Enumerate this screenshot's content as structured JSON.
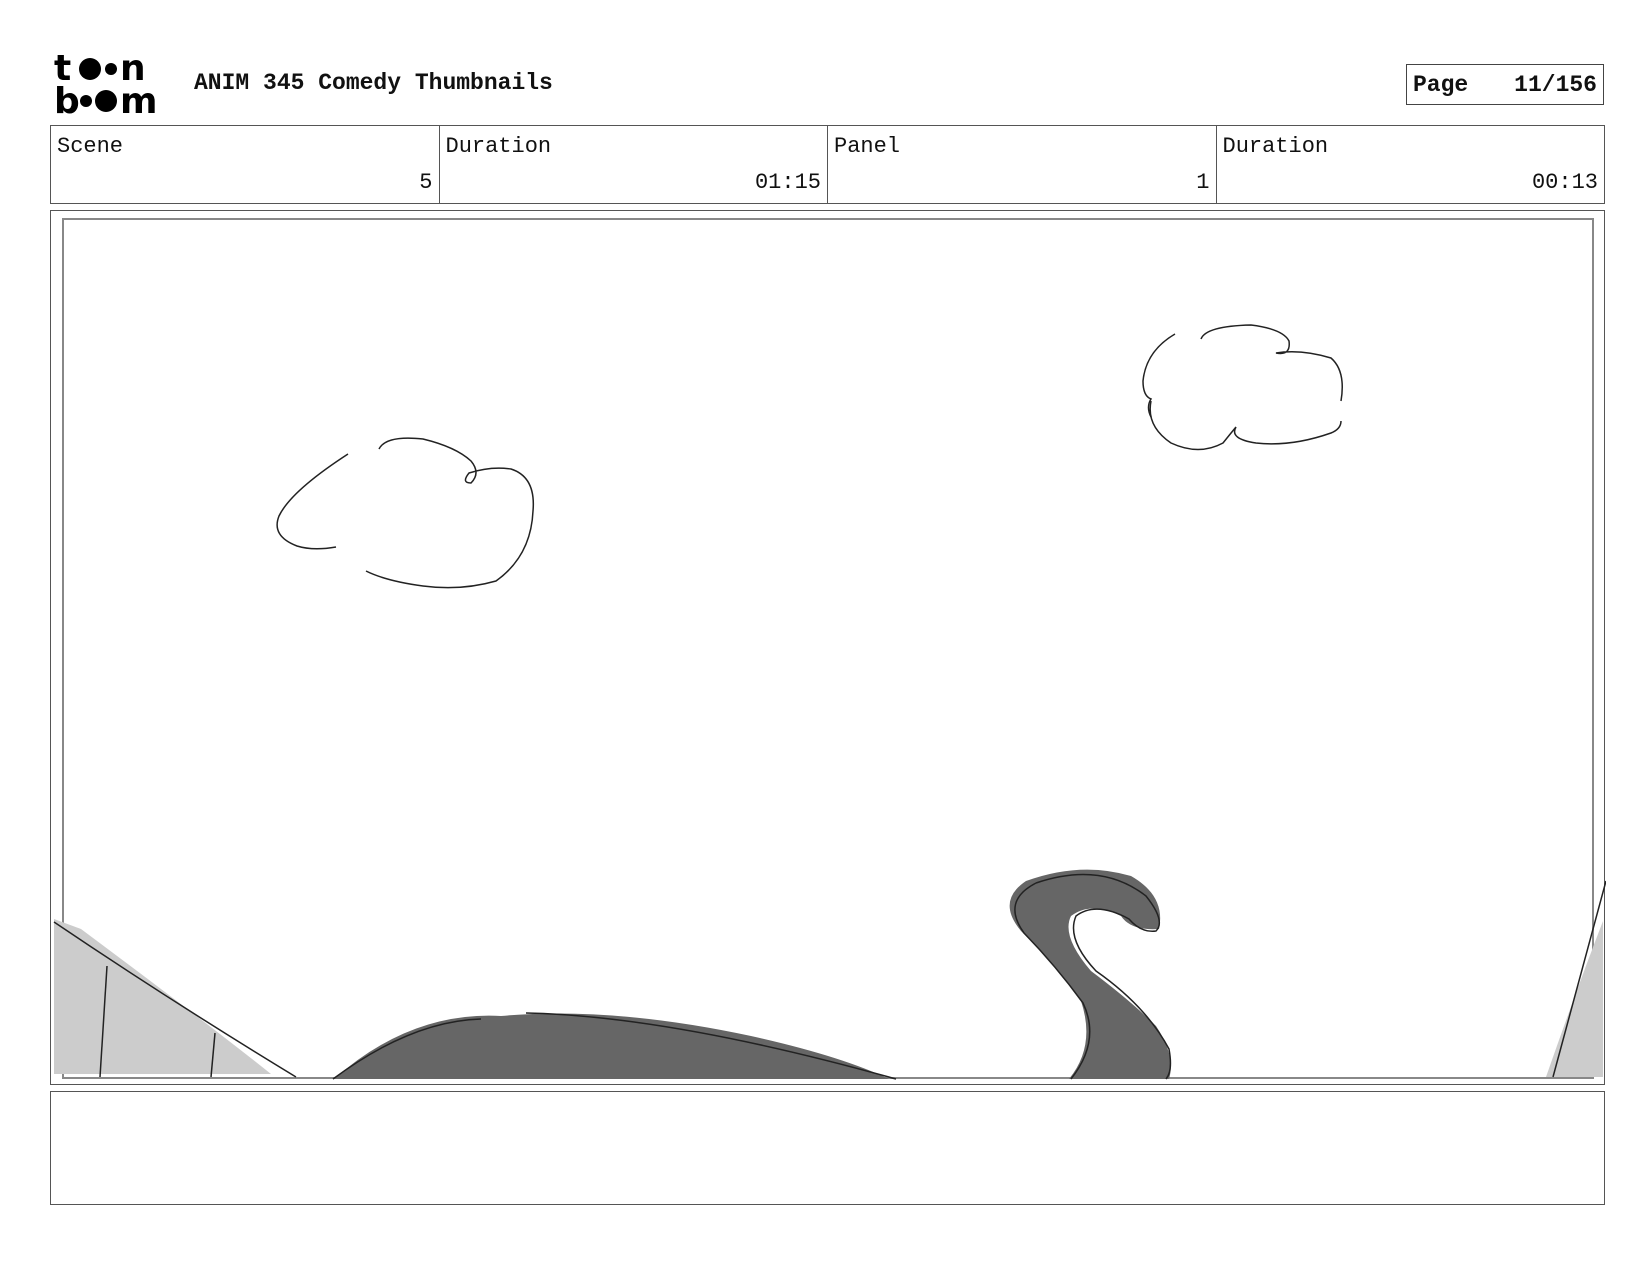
{
  "logo": {
    "line1": "toon",
    "line2": "boom"
  },
  "header": {
    "title": "ANIM 345 Comedy Thumbnails"
  },
  "page": {
    "label": "Page",
    "number": "11/156"
  },
  "info": {
    "scene_label": "Scene",
    "scene_value": "5",
    "scene_duration_label": "Duration",
    "scene_duration_value": "01:15",
    "panel_label": "Panel",
    "panel_value": "1",
    "panel_duration_label": "Duration",
    "panel_duration_value": "00:13"
  },
  "colors": {
    "ink": "#111111",
    "fill_dark": "#666666",
    "fill_light": "#cccccc",
    "border": "#555555"
  },
  "notes": {
    "text": ""
  }
}
